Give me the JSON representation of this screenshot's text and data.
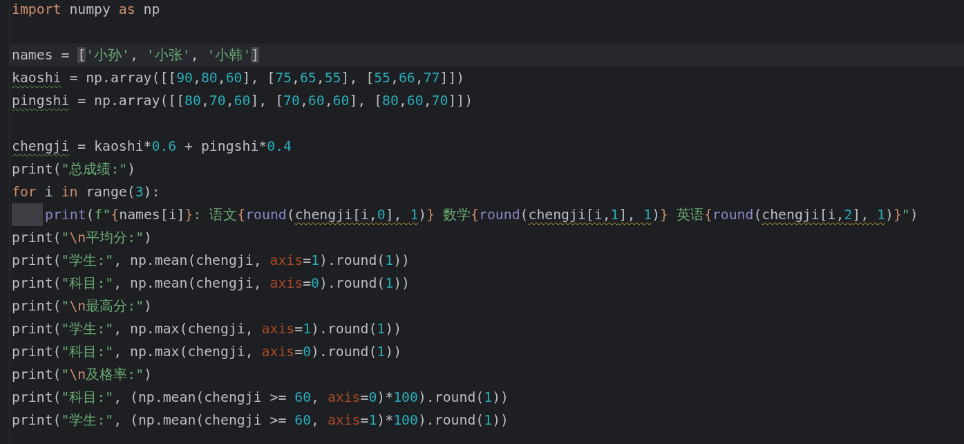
{
  "editor": {
    "lines": [
      {
        "current": false,
        "indent": false,
        "tokens": [
          {
            "kind": "kw",
            "text": "import"
          },
          {
            "kind": "t",
            "text": " numpy "
          },
          {
            "kind": "kw",
            "text": "as"
          },
          {
            "kind": "t",
            "text": " np"
          }
        ]
      },
      {
        "current": false,
        "indent": false
      },
      {
        "current": true,
        "indent": false,
        "tokens": [
          {
            "kind": "t",
            "text": "names = "
          },
          {
            "kind": "t",
            "text": "[",
            "matched": true
          },
          {
            "kind": "str",
            "text": "'小孙'"
          },
          {
            "kind": "t",
            "text": ", "
          },
          {
            "kind": "str",
            "text": "'小张'"
          },
          {
            "kind": "t",
            "text": ", "
          },
          {
            "kind": "str",
            "text": "'小韩'"
          },
          {
            "kind": "t",
            "text": "]",
            "matched": true
          }
        ]
      },
      {
        "current": false,
        "indent": false,
        "tokens": [
          {
            "kind": "t",
            "text": "kaoshi",
            "typo": true
          },
          {
            "kind": "t",
            "text": " = np.array([["
          },
          {
            "kind": "num",
            "text": "90"
          },
          {
            "kind": "t",
            "text": ","
          },
          {
            "kind": "num",
            "text": "80"
          },
          {
            "kind": "t",
            "text": ","
          },
          {
            "kind": "num",
            "text": "60"
          },
          {
            "kind": "t",
            "text": "], ["
          },
          {
            "kind": "num",
            "text": "75"
          },
          {
            "kind": "t",
            "text": ","
          },
          {
            "kind": "num",
            "text": "65"
          },
          {
            "kind": "t",
            "text": ","
          },
          {
            "kind": "num",
            "text": "55"
          },
          {
            "kind": "t",
            "text": "], ["
          },
          {
            "kind": "num",
            "text": "55"
          },
          {
            "kind": "t",
            "text": ","
          },
          {
            "kind": "num",
            "text": "66"
          },
          {
            "kind": "t",
            "text": ","
          },
          {
            "kind": "num",
            "text": "77"
          },
          {
            "kind": "t",
            "text": "]])"
          }
        ]
      },
      {
        "current": false,
        "indent": false,
        "tokens": [
          {
            "kind": "t",
            "text": "pingshi",
            "typo": true
          },
          {
            "kind": "t",
            "text": " = np.array([["
          },
          {
            "kind": "num",
            "text": "80"
          },
          {
            "kind": "t",
            "text": ","
          },
          {
            "kind": "num",
            "text": "70"
          },
          {
            "kind": "t",
            "text": ","
          },
          {
            "kind": "num",
            "text": "60"
          },
          {
            "kind": "t",
            "text": "], ["
          },
          {
            "kind": "num",
            "text": "70"
          },
          {
            "kind": "t",
            "text": ","
          },
          {
            "kind": "num",
            "text": "60"
          },
          {
            "kind": "t",
            "text": ","
          },
          {
            "kind": "num",
            "text": "60"
          },
          {
            "kind": "t",
            "text": "], ["
          },
          {
            "kind": "num",
            "text": "80"
          },
          {
            "kind": "t",
            "text": ","
          },
          {
            "kind": "num",
            "text": "60"
          },
          {
            "kind": "t",
            "text": ","
          },
          {
            "kind": "num",
            "text": "70"
          },
          {
            "kind": "t",
            "text": "]])"
          }
        ]
      },
      {
        "current": false,
        "indent": false
      },
      {
        "current": false,
        "indent": false,
        "tokens": [
          {
            "kind": "t",
            "text": "chengji",
            "typo": true
          },
          {
            "kind": "t",
            "text": " = kaoshi*"
          },
          {
            "kind": "num",
            "text": "0.6"
          },
          {
            "kind": "t",
            "text": " + pingshi*"
          },
          {
            "kind": "num",
            "text": "0.4"
          }
        ]
      },
      {
        "current": false,
        "indent": false,
        "tokens": [
          {
            "kind": "t",
            "text": "print("
          },
          {
            "kind": "str",
            "text": "\"总成绩:\""
          },
          {
            "kind": "t",
            "text": ")"
          }
        ]
      },
      {
        "current": false,
        "indent": false,
        "tokens": [
          {
            "kind": "kw",
            "text": "for"
          },
          {
            "kind": "t",
            "text": " i "
          },
          {
            "kind": "kw",
            "text": "in"
          },
          {
            "kind": "t",
            "text": " range("
          },
          {
            "kind": "num",
            "text": "3"
          },
          {
            "kind": "t",
            "text": "):"
          }
        ]
      },
      {
        "current": false,
        "indent": true,
        "tokens": [
          {
            "kind": "builtin",
            "text": "print"
          },
          {
            "kind": "t",
            "text": "("
          },
          {
            "kind": "str",
            "text": "f\""
          },
          {
            "kind": "brace",
            "text": "{"
          },
          {
            "kind": "t",
            "text": "names[i]"
          },
          {
            "kind": "brace",
            "text": "}"
          },
          {
            "kind": "str",
            "text": ": 语文"
          },
          {
            "kind": "brace",
            "text": "{"
          },
          {
            "kind": "builtin",
            "text": "round"
          },
          {
            "kind": "t",
            "text": "("
          },
          {
            "kind": "t",
            "text": "chengji[i,",
            "warning": true
          },
          {
            "kind": "num",
            "text": "0",
            "warning": true
          },
          {
            "kind": "t",
            "text": "], ",
            "warning": true
          },
          {
            "kind": "num",
            "text": "1",
            "warning": true
          },
          {
            "kind": "t",
            "text": ")"
          },
          {
            "kind": "brace",
            "text": "}"
          },
          {
            "kind": "str",
            "text": " 数学"
          },
          {
            "kind": "brace",
            "text": "{"
          },
          {
            "kind": "builtin",
            "text": "round"
          },
          {
            "kind": "t",
            "text": "("
          },
          {
            "kind": "t",
            "text": "chengji[i,",
            "warning": true
          },
          {
            "kind": "num",
            "text": "1",
            "warning": true
          },
          {
            "kind": "t",
            "text": "], ",
            "warning": true
          },
          {
            "kind": "num",
            "text": "1",
            "warning": true
          },
          {
            "kind": "t",
            "text": ")"
          },
          {
            "kind": "brace",
            "text": "}"
          },
          {
            "kind": "str",
            "text": " 英语"
          },
          {
            "kind": "brace",
            "text": "{"
          },
          {
            "kind": "builtin",
            "text": "round"
          },
          {
            "kind": "t",
            "text": "("
          },
          {
            "kind": "t",
            "text": "chengji[i,",
            "warning": true
          },
          {
            "kind": "num",
            "text": "2",
            "warning": true
          },
          {
            "kind": "t",
            "text": "], ",
            "warning": true
          },
          {
            "kind": "num",
            "text": "1",
            "warning": true
          },
          {
            "kind": "t",
            "text": ")"
          },
          {
            "kind": "brace",
            "text": "}"
          },
          {
            "kind": "str",
            "text": "\""
          },
          {
            "kind": "t",
            "text": ")"
          }
        ]
      },
      {
        "current": false,
        "indent": false,
        "tokens": [
          {
            "kind": "t",
            "text": "print("
          },
          {
            "kind": "str",
            "text": "\""
          },
          {
            "kind": "escape",
            "text": "\\n"
          },
          {
            "kind": "str",
            "text": "平均分:\""
          },
          {
            "kind": "t",
            "text": ")"
          }
        ]
      },
      {
        "current": false,
        "indent": false,
        "tokens": [
          {
            "kind": "t",
            "text": "print("
          },
          {
            "kind": "str",
            "text": "\"学生:\""
          },
          {
            "kind": "t",
            "text": ", np.mean(chengji, "
          },
          {
            "kind": "param",
            "text": "axis"
          },
          {
            "kind": "t",
            "text": "="
          },
          {
            "kind": "num",
            "text": "1"
          },
          {
            "kind": "t",
            "text": ").round("
          },
          {
            "kind": "num",
            "text": "1"
          },
          {
            "kind": "t",
            "text": "))"
          }
        ]
      },
      {
        "current": false,
        "indent": false,
        "tokens": [
          {
            "kind": "t",
            "text": "print("
          },
          {
            "kind": "str",
            "text": "\"科目:\""
          },
          {
            "kind": "t",
            "text": ", np.mean(chengji, "
          },
          {
            "kind": "param",
            "text": "axis"
          },
          {
            "kind": "t",
            "text": "="
          },
          {
            "kind": "num",
            "text": "0"
          },
          {
            "kind": "t",
            "text": ").round("
          },
          {
            "kind": "num",
            "text": "1"
          },
          {
            "kind": "t",
            "text": "))"
          }
        ]
      },
      {
        "current": false,
        "indent": false,
        "tokens": [
          {
            "kind": "t",
            "text": "print("
          },
          {
            "kind": "str",
            "text": "\""
          },
          {
            "kind": "escape",
            "text": "\\n"
          },
          {
            "kind": "str",
            "text": "最高分:\""
          },
          {
            "kind": "t",
            "text": ")"
          }
        ]
      },
      {
        "current": false,
        "indent": false,
        "tokens": [
          {
            "kind": "t",
            "text": "print("
          },
          {
            "kind": "str",
            "text": "\"学生:\""
          },
          {
            "kind": "t",
            "text": ", np.max(chengji, "
          },
          {
            "kind": "param",
            "text": "axis"
          },
          {
            "kind": "t",
            "text": "="
          },
          {
            "kind": "num",
            "text": "1"
          },
          {
            "kind": "t",
            "text": ").round("
          },
          {
            "kind": "num",
            "text": "1"
          },
          {
            "kind": "t",
            "text": "))"
          }
        ]
      },
      {
        "current": false,
        "indent": false,
        "tokens": [
          {
            "kind": "t",
            "text": "print("
          },
          {
            "kind": "str",
            "text": "\"科目:\""
          },
          {
            "kind": "t",
            "text": ", np.max(chengji, "
          },
          {
            "kind": "param",
            "text": "axis"
          },
          {
            "kind": "t",
            "text": "="
          },
          {
            "kind": "num",
            "text": "0"
          },
          {
            "kind": "t",
            "text": ").round("
          },
          {
            "kind": "num",
            "text": "1"
          },
          {
            "kind": "t",
            "text": "))"
          }
        ]
      },
      {
        "current": false,
        "indent": false,
        "tokens": [
          {
            "kind": "t",
            "text": "print("
          },
          {
            "kind": "str",
            "text": "\""
          },
          {
            "kind": "escape",
            "text": "\\n"
          },
          {
            "kind": "str",
            "text": "及格率:\""
          },
          {
            "kind": "t",
            "text": ")"
          }
        ]
      },
      {
        "current": false,
        "indent": false,
        "tokens": [
          {
            "kind": "t",
            "text": "print("
          },
          {
            "kind": "str",
            "text": "\"科目:\""
          },
          {
            "kind": "t",
            "text": ", (np.mean(chengji >= "
          },
          {
            "kind": "num",
            "text": "60"
          },
          {
            "kind": "t",
            "text": ", "
          },
          {
            "kind": "param",
            "text": "axis"
          },
          {
            "kind": "t",
            "text": "="
          },
          {
            "kind": "num",
            "text": "0"
          },
          {
            "kind": "t",
            "text": ")*"
          },
          {
            "kind": "num",
            "text": "100"
          },
          {
            "kind": "t",
            "text": ").round("
          },
          {
            "kind": "num",
            "text": "1"
          },
          {
            "kind": "t",
            "text": "))"
          }
        ]
      },
      {
        "current": false,
        "indent": false,
        "tokens": [
          {
            "kind": "t",
            "text": "print("
          },
          {
            "kind": "str",
            "text": "\"学生:\""
          },
          {
            "kind": "t",
            "text": ", (np.mean(chengji >= "
          },
          {
            "kind": "num",
            "text": "60"
          },
          {
            "kind": "t",
            "text": ", "
          },
          {
            "kind": "param",
            "text": "axis"
          },
          {
            "kind": "t",
            "text": "="
          },
          {
            "kind": "num",
            "text": "1"
          },
          {
            "kind": "t",
            "text": ")*"
          },
          {
            "kind": "num",
            "text": "100"
          },
          {
            "kind": "t",
            "text": ").round("
          },
          {
            "kind": "num",
            "text": "1"
          },
          {
            "kind": "t",
            "text": "))"
          }
        ]
      }
    ]
  }
}
